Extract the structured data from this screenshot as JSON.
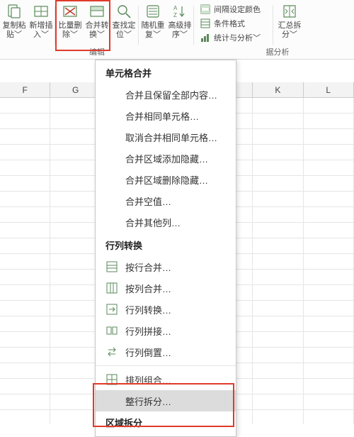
{
  "ribbon": {
    "groups": {
      "clipboard": {
        "copy_paste": "复制粘\n贴﹀",
        "insert": "新增插\n入﹀"
      },
      "edit": {
        "label": "编辑",
        "batch_delete": "比量删\n除﹀",
        "merge_convert": "合并转\n换﹀",
        "find_locate": "查找定\n位﹀"
      },
      "sort": {
        "random_rep": "随机重\n复﹀",
        "adv_sort": "高级排\n序﹀"
      },
      "format_mini": {
        "interval_color": "间隔设定颜色",
        "cond_format": "条件格式",
        "stats": "统计与分析﹀"
      },
      "analysis": {
        "label_partial": "据分析",
        "pivot_split": "汇总拆\n分﹀"
      }
    }
  },
  "menu": {
    "section1_title": "单元格合并",
    "section1": {
      "merge_keep_all": "合并且保留全部内容…",
      "merge_same": "合并相同单元格…",
      "unmerge_same": "取消合并相同单元格…",
      "merge_area_add_hide": "合并区域添加隐藏…",
      "merge_area_del_hide": "合并区域删除隐藏…",
      "merge_blank": "合并空值…",
      "merge_other_col": "合并其他列…"
    },
    "section2_title": "行列转换",
    "section2": {
      "by_row_merge": "按行合并…",
      "by_col_merge": "按列合并…",
      "row_col_convert": "行列转换…",
      "row_col_join": "行列拼接…",
      "row_col_reverse": "行列倒置…",
      "arrange_combo": "排列组合…",
      "row_split": "整行拆分…"
    },
    "section3_title_partial": "区域拆分"
  },
  "columns": [
    "F",
    "G",
    "",
    "",
    "",
    "K",
    "L"
  ]
}
